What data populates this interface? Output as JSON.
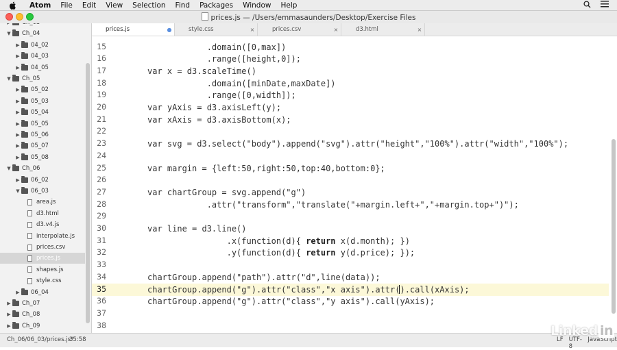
{
  "menubar": {
    "app": "Atom",
    "items": [
      "File",
      "Edit",
      "View",
      "Selection",
      "Find",
      "Packages",
      "Window",
      "Help"
    ]
  },
  "window": {
    "title": "prices.js — /Users/emmasaunders/Desktop/Exercise Files"
  },
  "tree": {
    "items": [
      {
        "label": "Ch_03",
        "type": "folder",
        "depth": 0,
        "expanded": false,
        "selected": false
      },
      {
        "label": "Ch_04",
        "type": "folder",
        "depth": 0,
        "expanded": true,
        "selected": false
      },
      {
        "label": "04_02",
        "type": "folder",
        "depth": 1,
        "expanded": false,
        "selected": false
      },
      {
        "label": "04_03",
        "type": "folder",
        "depth": 1,
        "expanded": false,
        "selected": false
      },
      {
        "label": "04_05",
        "type": "folder",
        "depth": 1,
        "expanded": false,
        "selected": false
      },
      {
        "label": "Ch_05",
        "type": "folder",
        "depth": 0,
        "expanded": true,
        "selected": false
      },
      {
        "label": "05_02",
        "type": "folder",
        "depth": 1,
        "expanded": false,
        "selected": false
      },
      {
        "label": "05_03",
        "type": "folder",
        "depth": 1,
        "expanded": false,
        "selected": false
      },
      {
        "label": "05_04",
        "type": "folder",
        "depth": 1,
        "expanded": false,
        "selected": false
      },
      {
        "label": "05_05",
        "type": "folder",
        "depth": 1,
        "expanded": false,
        "selected": false
      },
      {
        "label": "05_06",
        "type": "folder",
        "depth": 1,
        "expanded": false,
        "selected": false
      },
      {
        "label": "05_07",
        "type": "folder",
        "depth": 1,
        "expanded": false,
        "selected": false
      },
      {
        "label": "05_08",
        "type": "folder",
        "depth": 1,
        "expanded": false,
        "selected": false
      },
      {
        "label": "Ch_06",
        "type": "folder",
        "depth": 0,
        "expanded": true,
        "selected": false
      },
      {
        "label": "06_02",
        "type": "folder",
        "depth": 1,
        "expanded": false,
        "selected": false
      },
      {
        "label": "06_03",
        "type": "folder",
        "depth": 1,
        "expanded": true,
        "selected": false
      },
      {
        "label": "area.js",
        "type": "file",
        "depth": 2,
        "expanded": false,
        "selected": false
      },
      {
        "label": "d3.html",
        "type": "file",
        "depth": 2,
        "expanded": false,
        "selected": false
      },
      {
        "label": "d3.v4.js",
        "type": "file",
        "depth": 2,
        "expanded": false,
        "selected": false
      },
      {
        "label": "interpolate.js",
        "type": "file",
        "depth": 2,
        "expanded": false,
        "selected": false
      },
      {
        "label": "prices.csv",
        "type": "file",
        "depth": 2,
        "expanded": false,
        "selected": false
      },
      {
        "label": "prices.js",
        "type": "file",
        "depth": 2,
        "expanded": false,
        "selected": true
      },
      {
        "label": "shapes.js",
        "type": "file",
        "depth": 2,
        "expanded": false,
        "selected": false
      },
      {
        "label": "style.css",
        "type": "file",
        "depth": 2,
        "expanded": false,
        "selected": false
      },
      {
        "label": "06_04",
        "type": "folder",
        "depth": 1,
        "expanded": false,
        "selected": false
      },
      {
        "label": "Ch_07",
        "type": "folder",
        "depth": 0,
        "expanded": false,
        "selected": false
      },
      {
        "label": "Ch_08",
        "type": "folder",
        "depth": 0,
        "expanded": false,
        "selected": false
      },
      {
        "label": "Ch_09",
        "type": "folder",
        "depth": 0,
        "expanded": false,
        "selected": false
      }
    ]
  },
  "tabs": [
    {
      "label": "prices.js",
      "active": true,
      "close": "●"
    },
    {
      "label": "style.css",
      "active": false,
      "close": "×"
    },
    {
      "label": "prices.csv",
      "active": false,
      "close": "×"
    },
    {
      "label": "d3.html",
      "active": false,
      "close": "×"
    }
  ],
  "editor": {
    "cursor_line": 35,
    "lines": [
      {
        "n": "15",
        "parts": [
          {
            "t": "            .domain([0,max])"
          }
        ]
      },
      {
        "n": "16",
        "parts": [
          {
            "t": "            .range([height,0]);"
          }
        ]
      },
      {
        "n": "17",
        "parts": [
          {
            "t": "var x = d3.scaleTime()"
          }
        ]
      },
      {
        "n": "18",
        "parts": [
          {
            "t": "            .domain([minDate,maxDate])"
          }
        ]
      },
      {
        "n": "19",
        "parts": [
          {
            "t": "            .range([0,width]);"
          }
        ]
      },
      {
        "n": "20",
        "parts": [
          {
            "t": "var yAxis = d3.axisLeft(y);"
          }
        ]
      },
      {
        "n": "21",
        "parts": [
          {
            "t": "var xAxis = d3.axisBottom(x);"
          }
        ]
      },
      {
        "n": "22",
        "parts": [
          {
            "t": ""
          }
        ]
      },
      {
        "n": "23",
        "parts": [
          {
            "t": "var svg = d3.select(\"body\").append(\"svg\").attr(\"height\",\"100%\").attr(\"width\",\"100%\");"
          }
        ]
      },
      {
        "n": "24",
        "parts": [
          {
            "t": ""
          }
        ]
      },
      {
        "n": "25",
        "parts": [
          {
            "t": "var margin = {left:50,right:50,top:40,bottom:0};"
          }
        ]
      },
      {
        "n": "26",
        "parts": [
          {
            "t": ""
          }
        ]
      },
      {
        "n": "27",
        "parts": [
          {
            "t": "var chartGroup = svg.append(\"g\")"
          }
        ]
      },
      {
        "n": "28",
        "parts": [
          {
            "t": "            .attr(\"transform\",\"translate(\"+margin.left+\",\"+margin.top+\")\");"
          }
        ]
      },
      {
        "n": "29",
        "parts": [
          {
            "t": ""
          }
        ]
      },
      {
        "n": "30",
        "parts": [
          {
            "t": "var line = d3.line()"
          }
        ]
      },
      {
        "n": "31",
        "parts": [
          {
            "t": "                .x(function(d){ "
          },
          {
            "t": "return",
            "kw": true
          },
          {
            "t": " x(d.month); })"
          }
        ]
      },
      {
        "n": "32",
        "parts": [
          {
            "t": "                .y(function(d){ "
          },
          {
            "t": "return",
            "kw": true
          },
          {
            "t": " y(d.price); });"
          }
        ]
      },
      {
        "n": "33",
        "parts": [
          {
            "t": ""
          }
        ]
      },
      {
        "n": "34",
        "parts": [
          {
            "t": "chartGroup.append(\"path\").attr(\"d\",line(data));"
          }
        ]
      },
      {
        "n": "35",
        "parts": [
          {
            "t": "chartGroup.append(\"g\").attr(\"class\",\"x axis\").attr("
          },
          {
            "t": ")",
            "caret": true
          },
          {
            "t": ".call(xAxis);"
          }
        ]
      },
      {
        "n": "36",
        "parts": [
          {
            "t": "chartGroup.append(\"g\").attr(\"class\",\"y axis\").call(yAxis);"
          }
        ]
      },
      {
        "n": "37",
        "parts": [
          {
            "t": ""
          }
        ]
      },
      {
        "n": "38",
        "parts": [
          {
            "t": ""
          }
        ]
      }
    ]
  },
  "status": {
    "path": "Ch_06/06_03/prices.js*",
    "position": "35:58",
    "line_ending": "LF",
    "encoding": "UTF-8",
    "grammar": "JavaScript"
  },
  "watermark": {
    "text": "Linked",
    "badge": "in"
  }
}
